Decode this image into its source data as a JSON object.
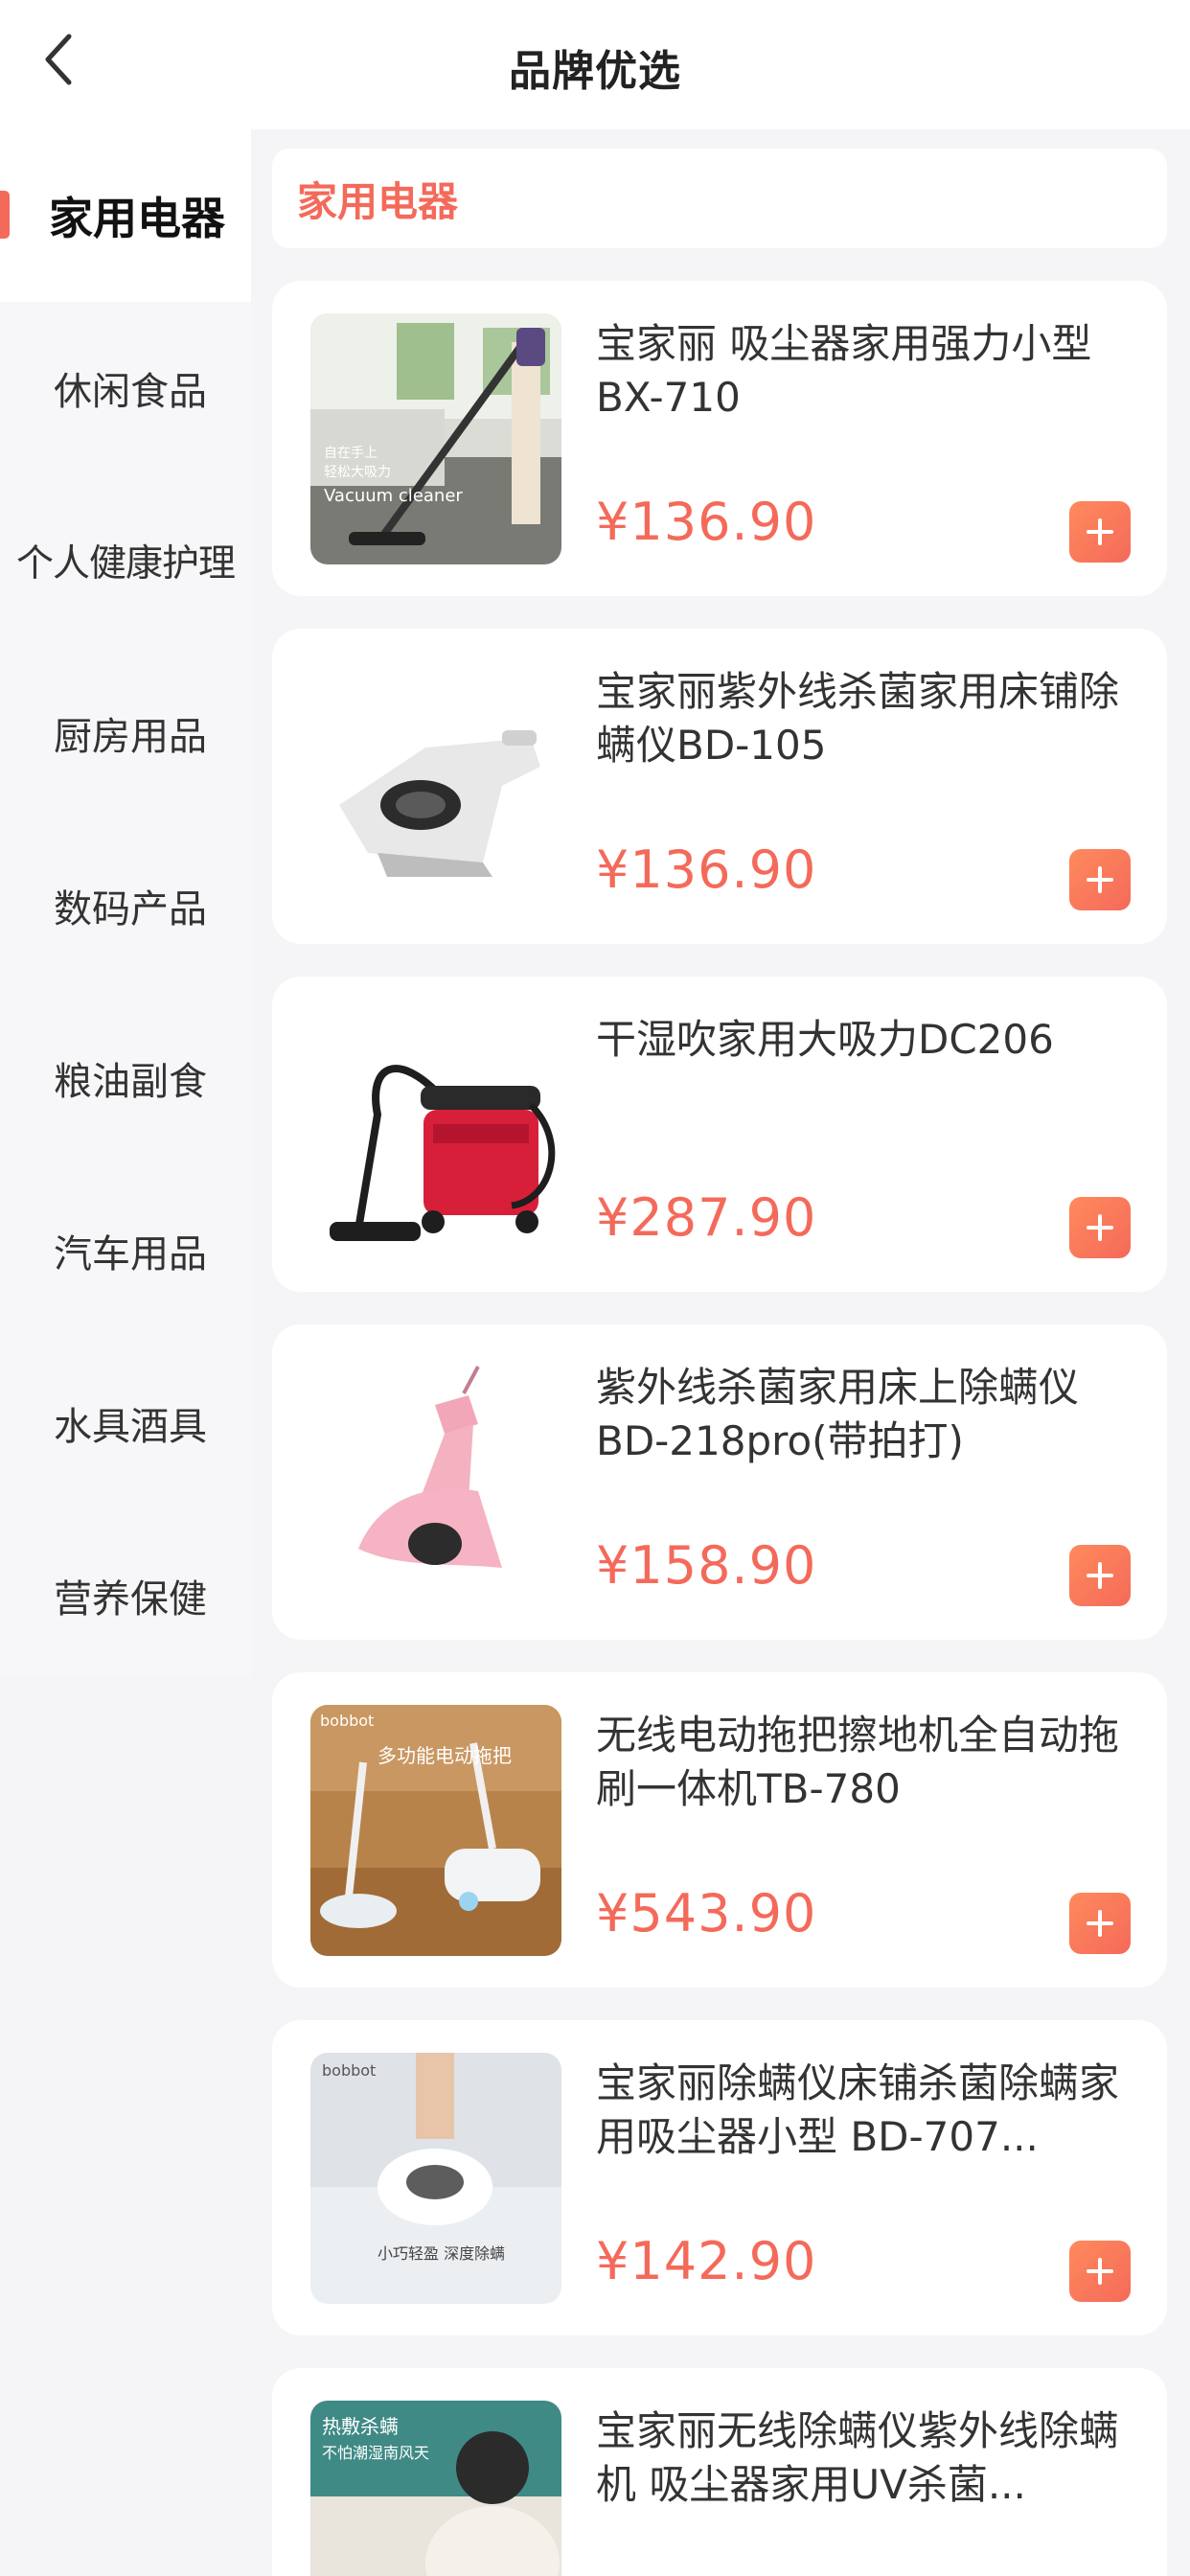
{
  "header": {
    "title": "品牌优选",
    "back_icon": "chevron-left-icon"
  },
  "sidebar": {
    "items": [
      {
        "label": "家用电器",
        "active": true
      },
      {
        "label": "休闲食品",
        "active": false
      },
      {
        "label": "个人健康护理",
        "active": false
      },
      {
        "label": "厨房用品",
        "active": false
      },
      {
        "label": "数码产品",
        "active": false
      },
      {
        "label": "粮油副食",
        "active": false
      },
      {
        "label": "汽车用品",
        "active": false
      },
      {
        "label": "水具酒具",
        "active": false
      },
      {
        "label": "营养保健",
        "active": false
      }
    ]
  },
  "main": {
    "section_title": "家用电器",
    "products": [
      {
        "name": "宝家丽 吸尘器家用强力小型BX-710",
        "price": "¥136.90",
        "image_texts": [
          "自在手上",
          "轻松大吸力",
          "Vacuum cleaner"
        ]
      },
      {
        "name": "宝家丽紫外线杀菌家用床铺除螨仪BD-105",
        "price": "¥136.90"
      },
      {
        "name": "干湿吹家用大吸力DC206",
        "price": "¥287.90"
      },
      {
        "name": "紫外线杀菌家用床上除螨仪BD-218pro(带拍打)",
        "price": "¥158.90"
      },
      {
        "name": "无线电动拖把擦地机全自动拖刷一体机TB-780",
        "price": "¥543.90",
        "image_texts": [
          "bobbot",
          "多功能电动拖把"
        ]
      },
      {
        "name": "宝家丽除螨仪床铺杀菌除螨家用吸尘器小型 BD-707...",
        "price": "¥142.90",
        "image_texts": [
          "bobbot",
          "小巧轻盈 深度除螨"
        ]
      },
      {
        "name": "宝家丽无线除螨仪紫外线除螨机 吸尘器家用UV杀菌...",
        "price": "",
        "image_texts": [
          "热敷杀螨",
          "不怕潮湿南风天"
        ]
      }
    ]
  },
  "colors": {
    "accent": "#f46a5a",
    "background": "#f5f5f7",
    "card": "#ffffff"
  }
}
